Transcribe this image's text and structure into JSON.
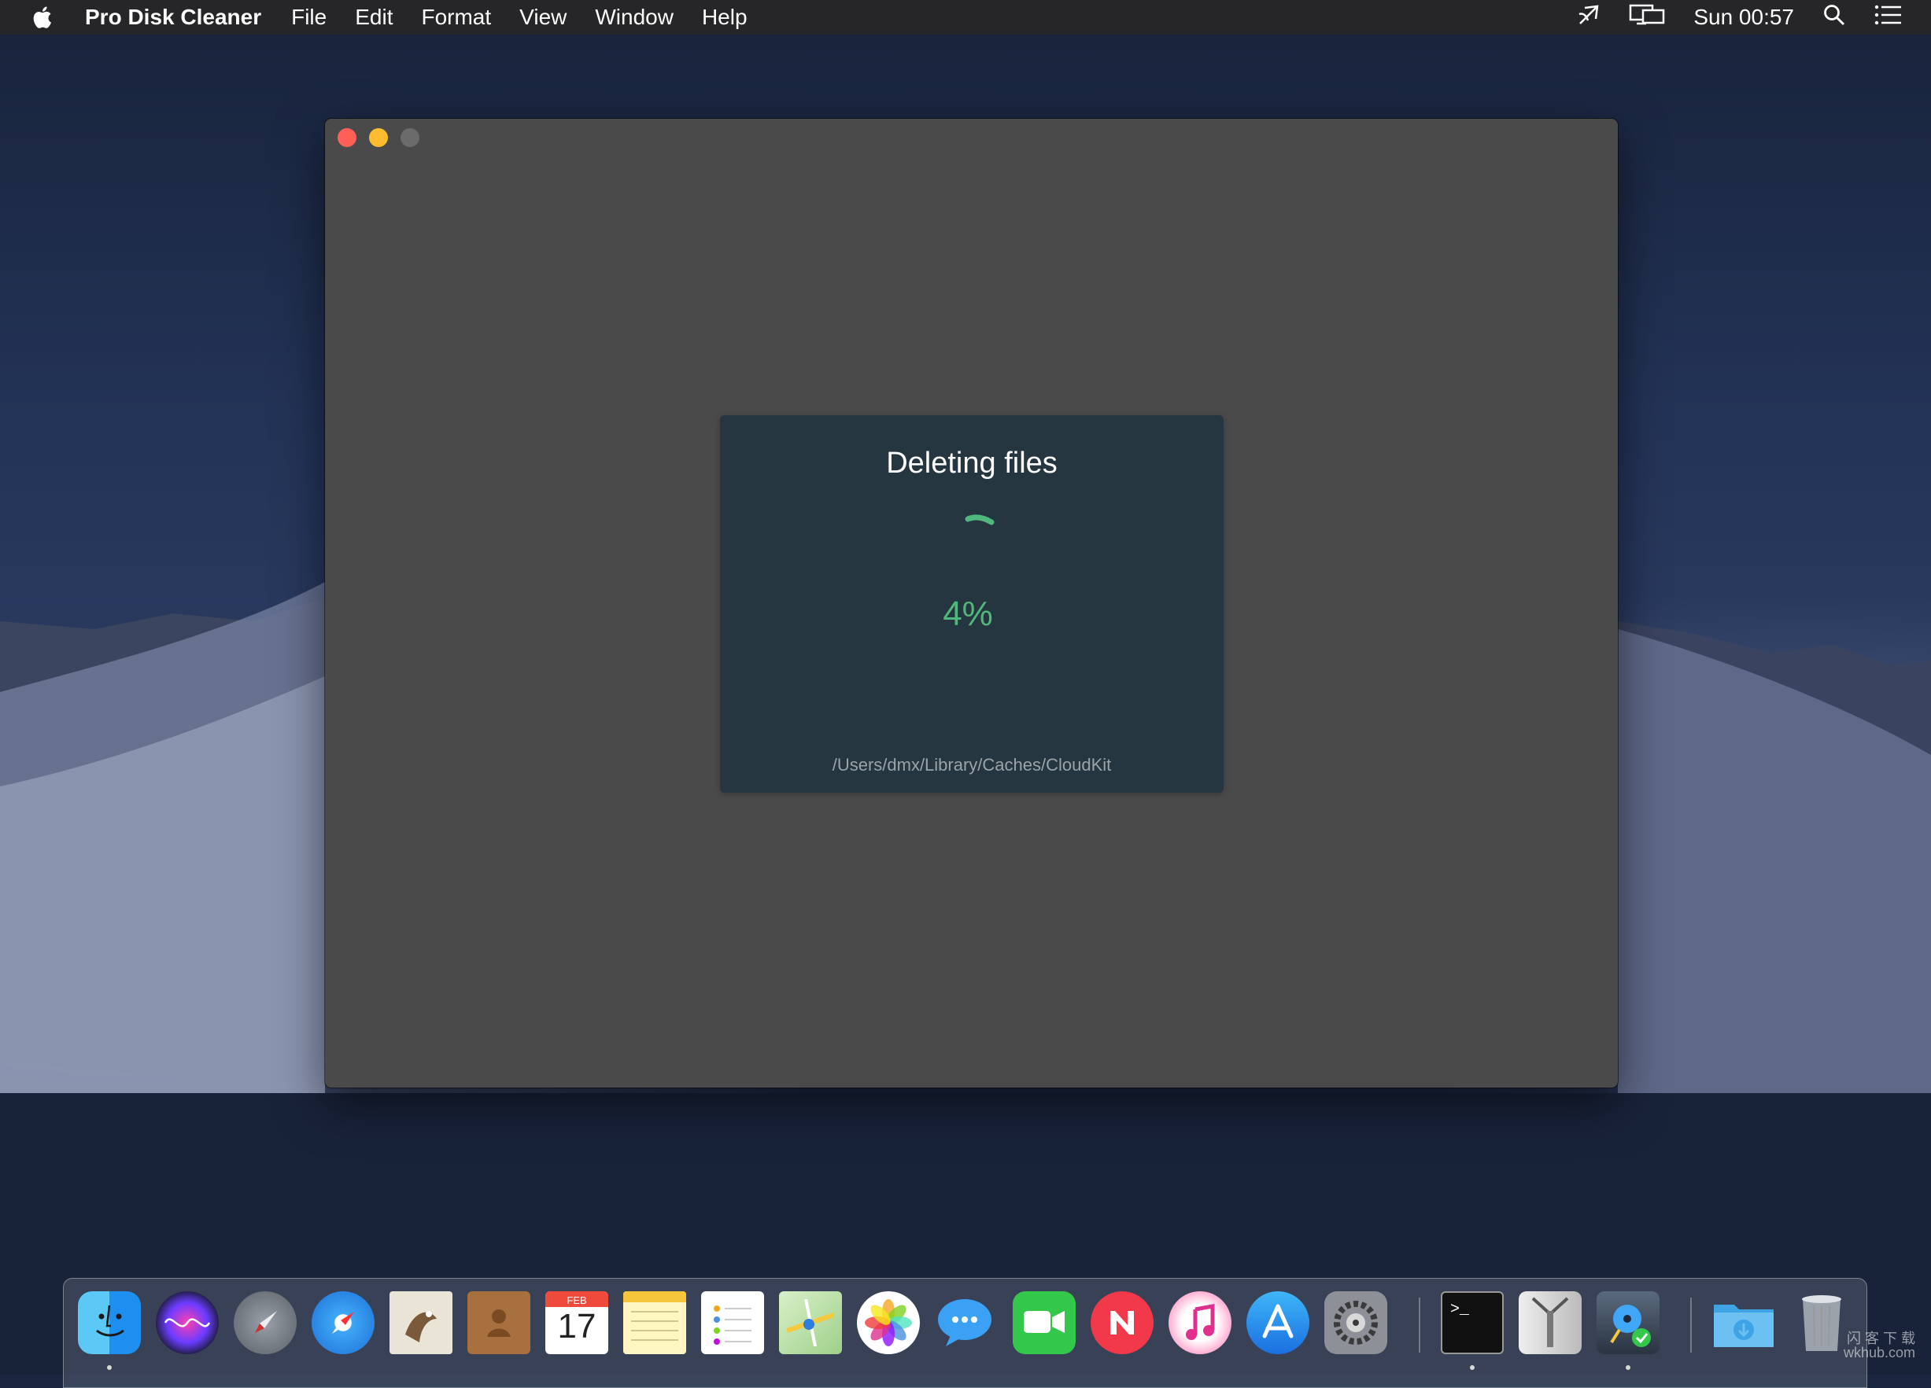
{
  "menubar": {
    "apple_icon": "apple-icon",
    "app_name": "Pro Disk Cleaner",
    "items": [
      "File",
      "Edit",
      "Format",
      "View",
      "Window",
      "Help"
    ],
    "status_icons": [
      "airplay-icon",
      "display-icon"
    ],
    "clock": "Sun 00:57",
    "search_icon": "search-icon",
    "notification_icon": "list-icon"
  },
  "window": {
    "controls": [
      "close",
      "minimize",
      "zoom"
    ],
    "colors": {
      "background": "#4a4a4a",
      "close": "#fe5f57",
      "minimize": "#febc2e",
      "zoom": "#6b6b6b"
    }
  },
  "progress": {
    "title": "Deleting files",
    "percent_label": "4%",
    "percent_value": 4,
    "current_path": "/Users/dmx/Library/Caches/CloudKit",
    "colors": {
      "panel": "#263640",
      "accent": "#4fb87a"
    }
  },
  "dock": {
    "apps": [
      "finder-icon",
      "siri-icon",
      "launchpad-icon",
      "safari-icon",
      "mail-icon",
      "contacts-icon",
      "calendar-icon",
      "notes-icon",
      "reminders-icon",
      "maps-icon",
      "photos-icon",
      "messages-icon",
      "facetime-icon",
      "news-icon",
      "itunes-icon",
      "app-store-icon",
      "system-preferences-icon",
      "terminal-icon",
      "archive-utility-icon",
      "pro-disk-cleaner-icon",
      "downloads-folder-icon",
      "trash-icon"
    ],
    "calendar": {
      "month": "FEB",
      "day": "17"
    },
    "terminal_prompt": ">_"
  },
  "watermark": {
    "line1": "闪 客 下 载",
    "line2": "wkhub.com"
  }
}
